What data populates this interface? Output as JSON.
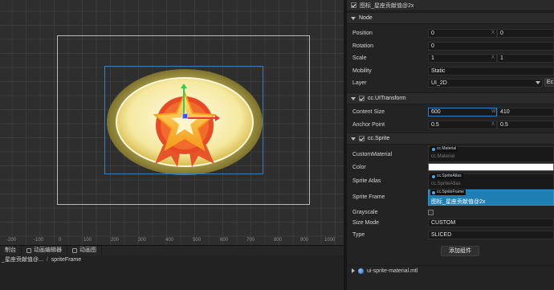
{
  "ruler": [
    "-200",
    "-100",
    "0",
    "100",
    "200",
    "300",
    "400",
    "500",
    "600",
    "700",
    "800",
    "900",
    "1000"
  ],
  "timeline": {
    "tabs": [
      {
        "label": "制台",
        "icon": "console-icon"
      },
      {
        "label": "动画编辑器",
        "icon": "animation-editor-icon"
      },
      {
        "label": "动画图",
        "icon": "animation-graph-icon"
      }
    ],
    "node_label": "_星座贡献值@...",
    "separator": "/",
    "property_label": "spriteFrame"
  },
  "inspector": {
    "node_name": "图标_星座贡献值@2x",
    "node": {
      "section": "Node",
      "position": {
        "label": "Position",
        "x": "0",
        "y": "0"
      },
      "rotation": {
        "label": "Rotation",
        "value": "0"
      },
      "scale": {
        "label": "Scale",
        "x": "1",
        "y": "1"
      },
      "mobility": {
        "label": "Mobility",
        "value": "Static"
      },
      "layer": {
        "label": "Layer",
        "value": "UI_2D",
        "edit_label": "Ec"
      }
    },
    "uitransform": {
      "section": "cc.UITransform",
      "content_size": {
        "label": "Content Size",
        "w": "600",
        "h": "410",
        "w_axis": "W",
        "h_axis": "H"
      },
      "anchor_point": {
        "label": "Anchor Point",
        "x": "0.5",
        "y": "0.5"
      }
    },
    "sprite": {
      "section": "cc.Sprite",
      "custom_material": {
        "label": "CustomMaterial",
        "tag": "cc.Material",
        "value": "cc.Material"
      },
      "color": {
        "label": "Color",
        "value": "#ffffff"
      },
      "sprite_atlas": {
        "label": "Sprite Atlas",
        "tag": "cc.SpriteAtlas",
        "value": "cc.SpriteAtlas"
      },
      "sprite_frame": {
        "label": "Sprite Frame",
        "tag": "cc.SpriteFrame",
        "value": "图标_星座贡献值@2x"
      },
      "grayscale": {
        "label": "Grayscale"
      },
      "size_mode": {
        "label": "Size Mode",
        "value": "CUSTOM"
      },
      "type": {
        "label": "Type",
        "value": "SLICED"
      }
    },
    "add_component": "添加组件",
    "material_file": "ui-sprite-material.mtl"
  }
}
